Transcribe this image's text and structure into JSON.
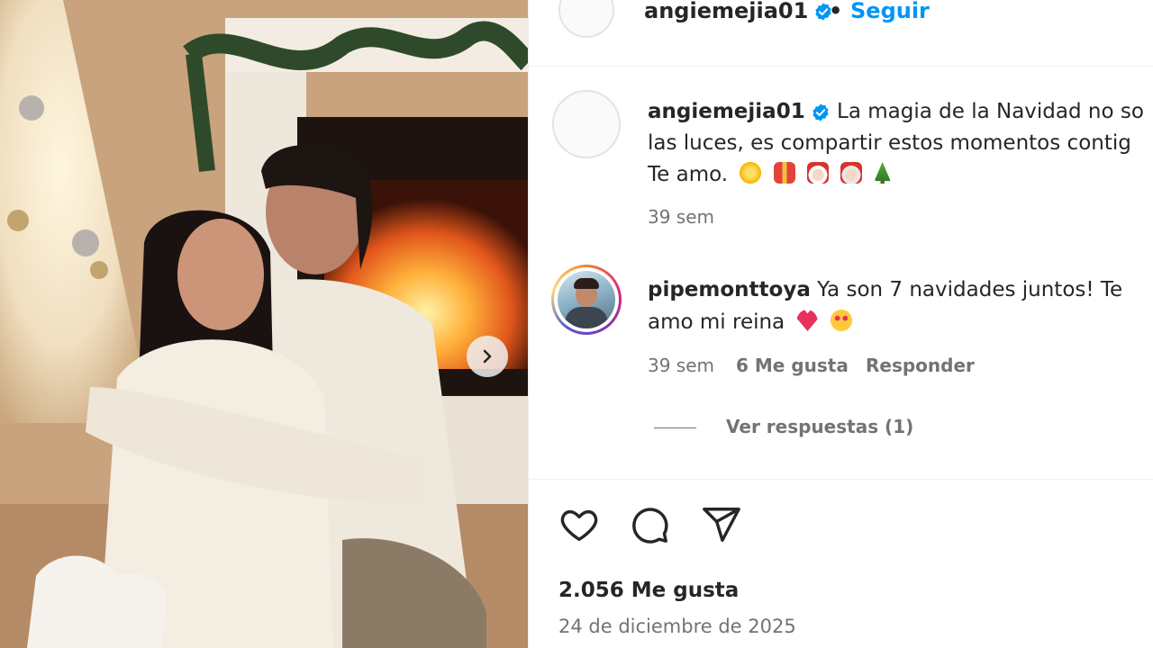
{
  "post": {
    "username": "angiemejia01",
    "follow_label": "Seguir",
    "separator": "•"
  },
  "caption": {
    "username": "angiemejia01",
    "line1": "La magia de la Navidad no so",
    "line2": "las luces, es compartir estos momentos contig",
    "line3": "Te amo.",
    "emojis": [
      "sparkles",
      "gift",
      "santa",
      "mrs-claus",
      "christmas-tree"
    ],
    "time": "39 sem"
  },
  "comment": {
    "username": "pipemonttoya",
    "text_line1": "Ya son 7 navidades juntos! Te",
    "text_line2": "amo mi reina",
    "emojis": [
      "heart",
      "heart-eyes"
    ],
    "time": "39 sem",
    "likes": "6 Me gusta",
    "reply_label": "Responder",
    "view_replies": "Ver respuestas (1)"
  },
  "footer": {
    "likes": "2.056 Me gusta",
    "date": "24 de diciembre de 2025"
  },
  "colors": {
    "link": "#0095f6",
    "muted": "#737373",
    "text": "#262626",
    "verified": "#0095f6"
  },
  "icons": [
    "verified-badge-icon",
    "chevron-right-icon",
    "heart-icon",
    "comment-icon",
    "share-icon"
  ]
}
